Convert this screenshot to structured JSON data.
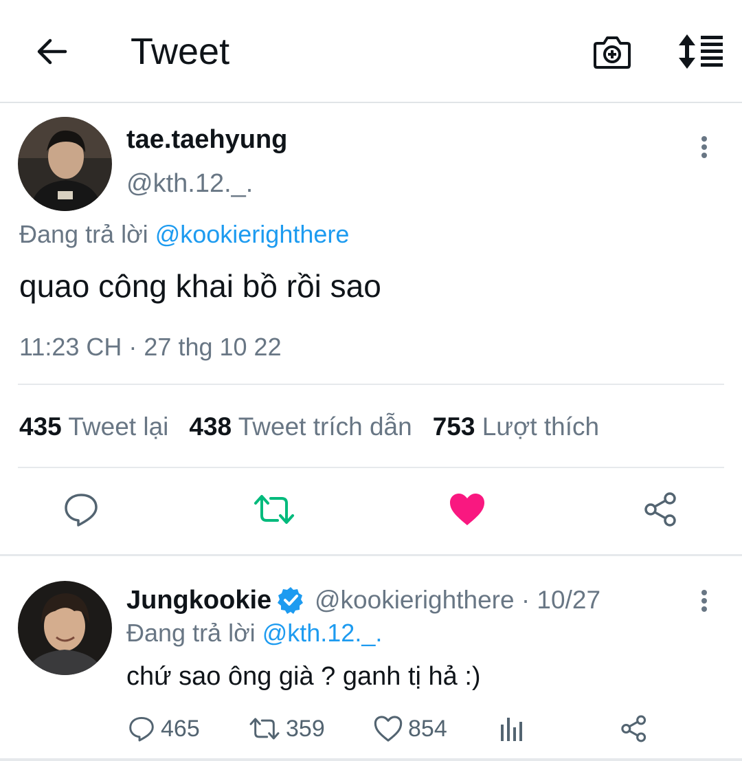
{
  "header": {
    "title": "Tweet"
  },
  "main_tweet": {
    "display_name": "tae.taehyung",
    "handle": "@kth.12._.",
    "reply_prefix": "Đang trả lời",
    "reply_to": "@kookierighthere",
    "text": "quao công khai bồ rồi sao",
    "timestamp": "11:23 CH · 27 thg 10 22",
    "stats": {
      "retweets_count": "435",
      "retweets_label": "Tweet lại",
      "quotes_count": "438",
      "quotes_label": "Tweet trích dẫn",
      "likes_count": "753",
      "likes_label": "Lượt thích"
    },
    "liked": true
  },
  "reply_tweet": {
    "display_name": "Jungkookie",
    "verified": true,
    "handle_date": "@kookierighthere · 10/27",
    "reply_prefix": "Đang trả lời",
    "reply_to": "@kth.12._.",
    "text": "chứ sao ông già ? ganh tị hả :)",
    "reply_count": "465",
    "retweet_count": "359",
    "like_count": "854"
  },
  "colors": {
    "accent": "#1d9bf0",
    "like": "#f91880",
    "retweet": "#00ba7c",
    "secondary_text": "#687684"
  },
  "icons": [
    "back-arrow-icon",
    "camera-plus-icon",
    "sort-icon",
    "more-vertical-icon",
    "reply-icon",
    "retweet-icon",
    "heart-icon",
    "share-icon",
    "verified-icon",
    "analytics-icon"
  ]
}
